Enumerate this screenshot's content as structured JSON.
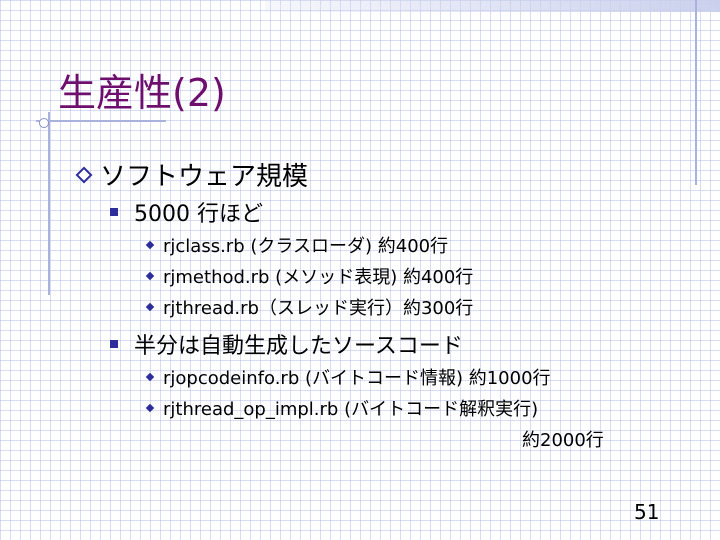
{
  "slide": {
    "title": "生産性(2)",
    "level1": "ソフトウェア規模",
    "group1": {
      "heading": "5000 行ほど",
      "items": [
        "rjclass.rb (クラスローダ) 約400行",
        "rjmethod.rb (メソッド表現) 約400行",
        "rjthread.rb（スレッド実行）約300行"
      ]
    },
    "group2": {
      "heading": "半分は自動生成したソースコード",
      "items": [
        "rjopcodeinfo.rb (バイトコード情報) 約1000行",
        "rjthread_op_impl.rb (バイトコード解釈実行)"
      ],
      "item2_continuation": "約2000行"
    },
    "page_number": "51"
  },
  "colors": {
    "title": "#6e0f6e",
    "bullet": "#2d2d9b",
    "grid": "#aab4e1"
  }
}
